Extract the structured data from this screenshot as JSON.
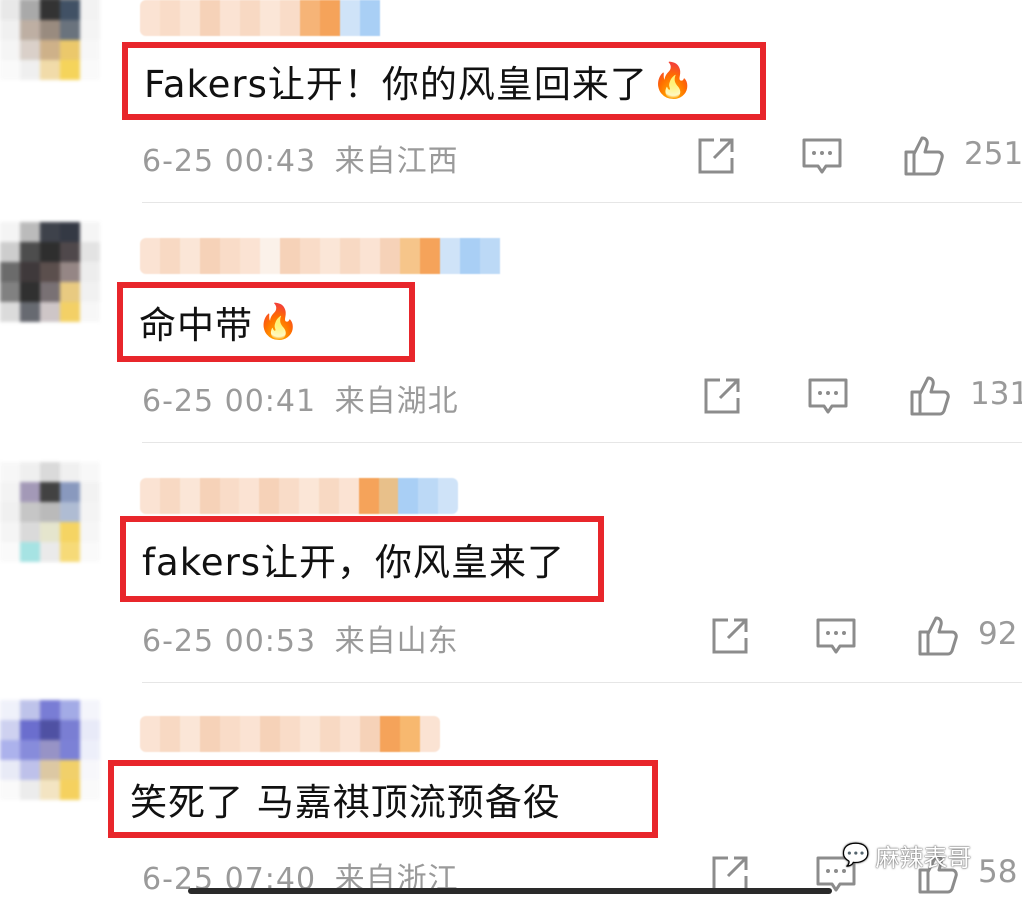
{
  "comments": [
    {
      "text": "Fakers让开！你的风皇回来了",
      "emoji": "🔥",
      "time": "6-25 00:43",
      "location": "来自江西",
      "likes": "251"
    },
    {
      "text": "命中带",
      "emoji": "🔥",
      "time": "6-25 00:41",
      "location": "来自湖北",
      "likes": "131"
    },
    {
      "text": "fakers让开，你风皇来了",
      "emoji": "",
      "time": "6-25 00:53",
      "location": "来自山东",
      "likes": "92"
    },
    {
      "text": "笑死了 马嘉祺顶流预备役",
      "emoji": "",
      "time": "6-25 07:40",
      "location": "来自浙江",
      "likes": "58"
    }
  ],
  "icons": {
    "share": "share-icon",
    "reply": "comment-icon",
    "like": "thumbs-up-icon",
    "watermark": "wechat-icon"
  },
  "watermark": {
    "text": "麻辣表哥"
  },
  "colors": {
    "highlight_border": "#e8262b",
    "meta_text": "#9a9a9a"
  }
}
